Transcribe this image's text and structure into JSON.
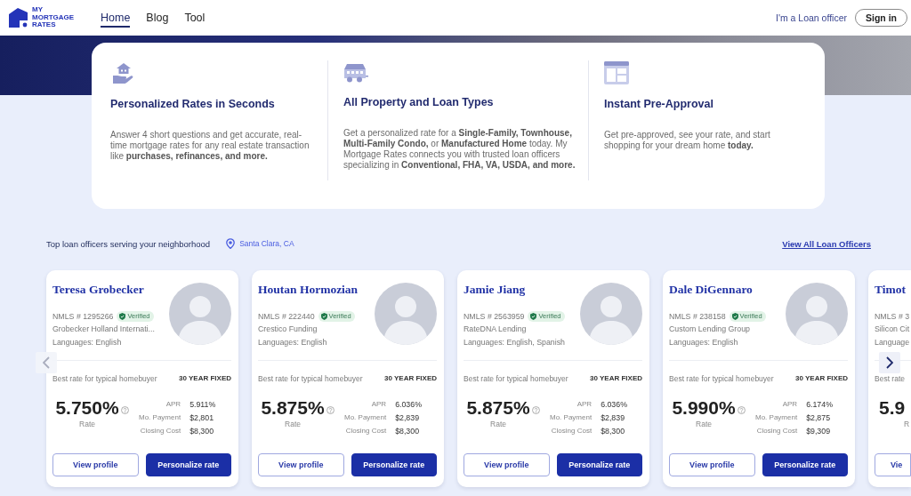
{
  "header": {
    "logo_text": "MY MORTGAGE RATES",
    "nav": [
      {
        "label": "Home",
        "selected": true
      },
      {
        "label": "Blog",
        "selected": false
      },
      {
        "label": "Tool",
        "selected": false
      }
    ],
    "loan_officer_link": "I'm a Loan officer",
    "sign_in_button": "Sign in"
  },
  "features": [
    {
      "title": "Personalized Rates in Seconds",
      "body": "Answer 4 short questions and get accurate, real-time mortgage rates for any real estate transaction like **purchases, refinances, and more.**"
    },
    {
      "title": "All Property and Loan Types",
      "body": "Get a personalized rate for a **Single-Family, Townhouse, Multi-Family Condo,** or **Manufactured Home** today. My Mortgage Rates connects you with trusted loan officers specializing in **Conventional, FHA, VA, USDA, and more.**"
    },
    {
      "title": "Instant Pre-Approval",
      "body": "Get pre-approved, see your rate, and start shopping for your dream home **today.**"
    }
  ],
  "officers": {
    "heading": "Top loan officers serving your neighborhood",
    "location": "Santa Clara, CA",
    "view_all_link": "View All Loan Officers",
    "cards": [
      {
        "name": "Teresa Grobecker",
        "nmls": "NMLS # 1295266",
        "badge": "Verified",
        "company": "Grobecker Holland Internati...",
        "languages": "Languages: English",
        "best_rate_label": "Best rate for typical homebuyer",
        "term": "30 YEAR FIXED",
        "rate": "5.750%",
        "rate_label": "Rate",
        "details": [
          {
            "label": "APR",
            "value": "5.911%"
          },
          {
            "label": "Mo. Payment",
            "value": "$2,801"
          },
          {
            "label": "Closing Cost",
            "value": "$8,300"
          }
        ],
        "buttons": [
          {
            "label": "View profile",
            "kind": "outline"
          },
          {
            "label": "Personalize rate",
            "kind": "primary"
          }
        ]
      },
      {
        "name": "Houtan Hormozian",
        "nmls": "NMLS # 222440",
        "badge": "Verified",
        "company": "Crestico Funding",
        "languages": "Languages: English",
        "best_rate_label": "Best rate for typical homebuyer",
        "term": "30 YEAR FIXED",
        "rate": "5.875%",
        "rate_label": "Rate",
        "details": [
          {
            "label": "APR",
            "value": "6.036%"
          },
          {
            "label": "Mo. Payment",
            "value": "$2,839"
          },
          {
            "label": "Closing Cost",
            "value": "$8,300"
          }
        ],
        "buttons": [
          {
            "label": "View profile",
            "kind": "outline"
          },
          {
            "label": "Personalize rate",
            "kind": "primary"
          }
        ]
      },
      {
        "name": "Jamie Jiang",
        "nmls": "NMLS # 2563959",
        "badge": "Verified",
        "company": "RateDNA Lending",
        "languages": "Languages: English, Spanish",
        "best_rate_label": "Best rate for typical homebuyer",
        "term": "30 YEAR FIXED",
        "rate": "5.875%",
        "rate_label": "Rate",
        "details": [
          {
            "label": "APR",
            "value": "6.036%"
          },
          {
            "label": "Mo. Payment",
            "value": "$2,839"
          },
          {
            "label": "Closing Cost",
            "value": "$8,300"
          }
        ],
        "buttons": [
          {
            "label": "View profile",
            "kind": "outline"
          },
          {
            "label": "Personalize rate",
            "kind": "primary"
          }
        ]
      },
      {
        "name": "Dale DiGennaro",
        "nmls": "NMLS # 238158",
        "badge": "Verified",
        "company": "Custom Lending Group",
        "languages": "Languages: English",
        "best_rate_label": "Best rate for typical homebuyer",
        "term": "30 YEAR FIXED",
        "rate": "5.990%",
        "rate_label": "Rate",
        "details": [
          {
            "label": "APR",
            "value": "6.174%"
          },
          {
            "label": "Mo. Payment",
            "value": "$2,875"
          },
          {
            "label": "Closing Cost",
            "value": "$9,309"
          }
        ],
        "buttons": [
          {
            "label": "View profile",
            "kind": "outline"
          },
          {
            "label": "Personalize rate",
            "kind": "primary"
          }
        ]
      }
    ],
    "partial_card": {
      "name": "Timot",
      "nmls": "NMLS # 3",
      "company": "Silicon Cit",
      "languages": "Language",
      "best_rate_label": "Best rate",
      "rate": "5.9",
      "rate_label": "R",
      "button": "Vie"
    },
    "carousel": {
      "prev": {
        "disabled": true
      },
      "next": {
        "disabled": false
      }
    }
  }
}
